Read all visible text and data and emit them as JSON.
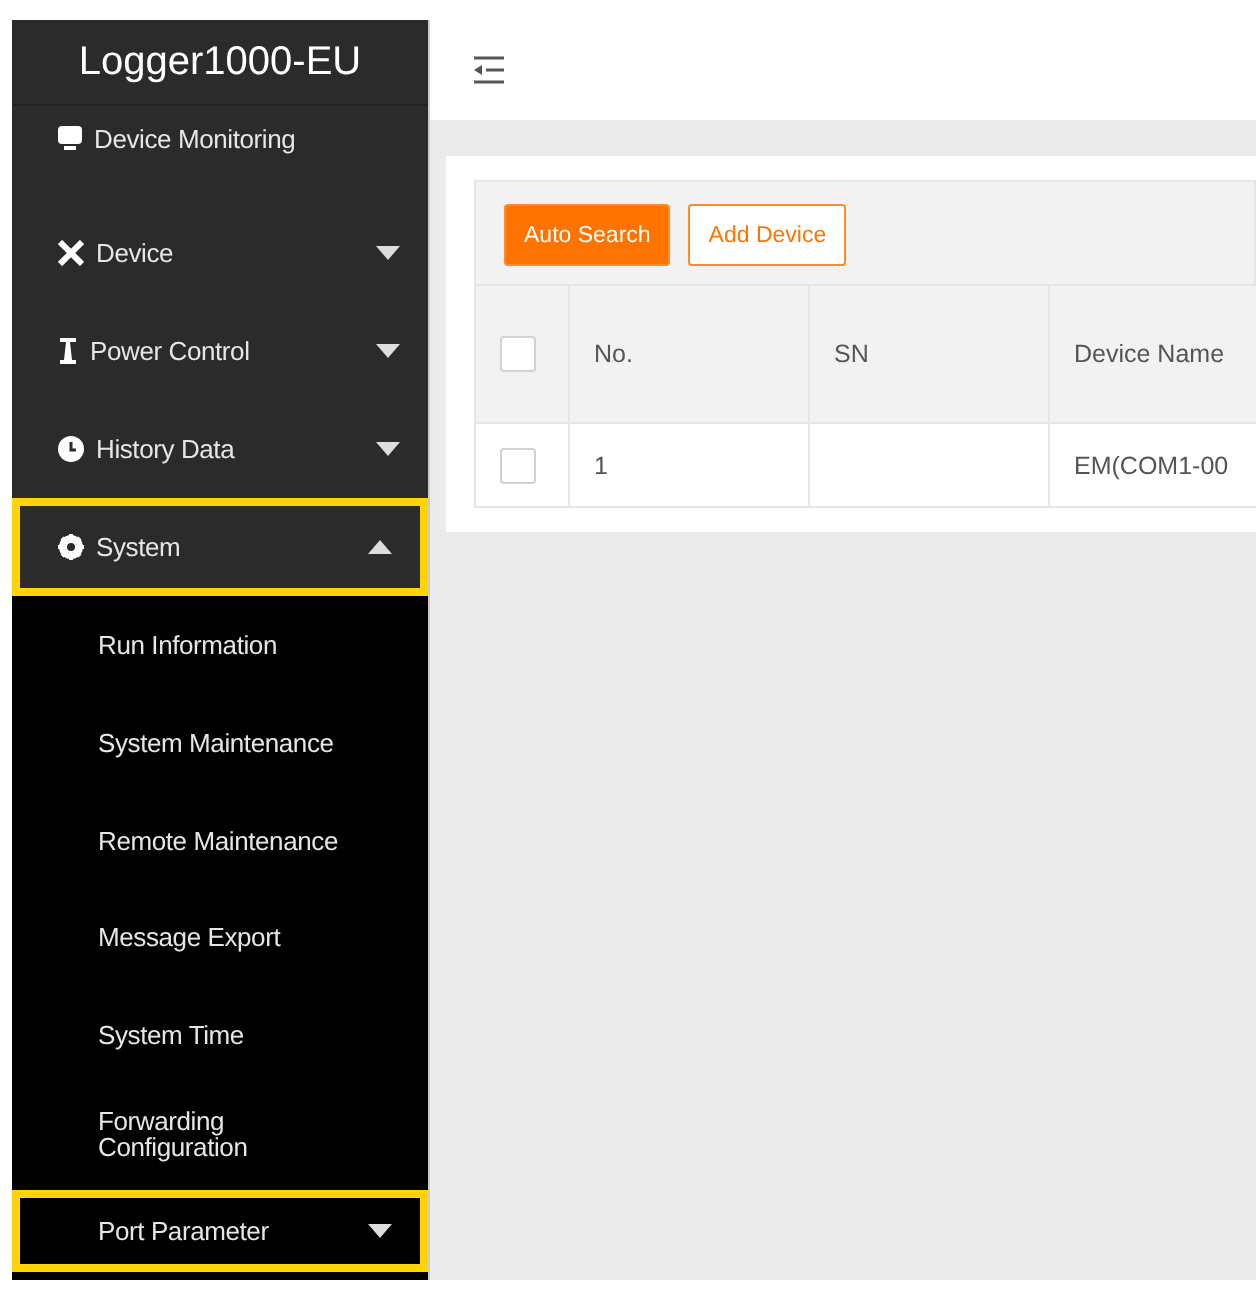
{
  "sidebar": {
    "title": "Logger1000-EU",
    "items": [
      {
        "label": "Device Monitoring",
        "kind": "monitor",
        "highlighted": false
      },
      {
        "label": "Device",
        "kind": "tools",
        "expanded": false,
        "highlighted": false
      },
      {
        "label": "Power Control",
        "kind": "tower",
        "expanded": false,
        "highlighted": false
      },
      {
        "label": "History Data",
        "kind": "clock",
        "expanded": false,
        "highlighted": false
      },
      {
        "label": "System",
        "kind": "gear",
        "expanded": true,
        "highlighted": true,
        "children": [
          {
            "label": "Run Information",
            "highlighted": false
          },
          {
            "label": "System Maintenance",
            "highlighted": false
          },
          {
            "label": "Remote Maintenance",
            "highlighted": false
          },
          {
            "label": "Message Export",
            "highlighted": false
          },
          {
            "label": "System Time",
            "highlighted": false
          },
          {
            "label": "Forwarding Configuration",
            "highlighted": false
          },
          {
            "label": "Port Parameter",
            "expanded": false,
            "highlighted": true
          }
        ]
      }
    ]
  },
  "toolbar": {
    "buttons": [
      {
        "label": "Auto Search",
        "kind": "primary"
      },
      {
        "label": "Add Device",
        "kind": "outline"
      }
    ]
  },
  "table": {
    "columns": [
      "No.",
      "SN",
      "Device Name"
    ],
    "header_checked": false,
    "rows": [
      {
        "checked": false,
        "cells": [
          "1",
          "",
          "EM(COM1-00"
        ]
      }
    ]
  }
}
